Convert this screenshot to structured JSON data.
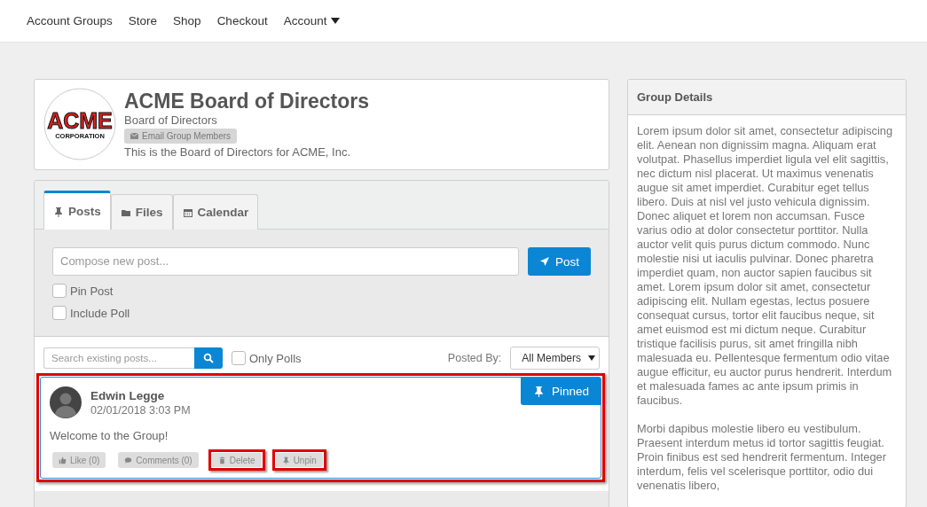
{
  "nav": [
    {
      "label": "Account Groups",
      "dropdown": false
    },
    {
      "label": "Store",
      "dropdown": false
    },
    {
      "label": "Shop",
      "dropdown": false
    },
    {
      "label": "Checkout",
      "dropdown": false
    },
    {
      "label": "Account",
      "dropdown": true
    }
  ],
  "group": {
    "logo": {
      "name": "ACME",
      "subtitle": "CORPORATION"
    },
    "title": "ACME Board of Directors",
    "subtitle": "Board of Directors",
    "email_button": "Email Group Members",
    "description": "This is the Board of Directors for ACME, Inc."
  },
  "tabs": [
    {
      "label": "Posts",
      "kind": "pin",
      "selected": true
    },
    {
      "label": "Files",
      "kind": "folder",
      "selected": false
    },
    {
      "label": "Calendar",
      "kind": "calendar",
      "selected": false
    }
  ],
  "composer": {
    "placeholder": "Compose new post...",
    "post_button": "Post",
    "options": [
      {
        "label": "Pin Post",
        "checked": false
      },
      {
        "label": "Include Poll",
        "checked": false
      }
    ]
  },
  "filter": {
    "search_placeholder": "Search existing posts...",
    "only_polls": {
      "label": "Only Polls",
      "checked": false
    },
    "posted_by_label": "Posted By:",
    "posted_by_value": "All Members"
  },
  "posts": [
    {
      "author": "Edwin Legge",
      "date": "02/01/2018 3:03 PM",
      "body": "Welcome to the Group!",
      "pinned": true,
      "pinned_label": "Pinned",
      "highlighted": true,
      "actions": [
        {
          "label": "Like (0)",
          "kind": "thumb",
          "highlighted": false
        },
        {
          "label": "Comments (0)",
          "kind": "comment",
          "highlighted": false
        },
        {
          "label": "Delete",
          "kind": "trash",
          "highlighted": true
        },
        {
          "label": "Unpin",
          "kind": "pin",
          "highlighted": true
        }
      ]
    }
  ],
  "details": {
    "title": "Group Details",
    "paragraphs": [
      "Lorem ipsum dolor sit amet, consectetur adipiscing elit. Aenean non dignissim magna. Aliquam erat volutpat. Phasellus imperdiet ligula vel elit sagittis, nec dictum nisl placerat. Ut maximus venenatis augue sit amet imperdiet. Curabitur eget tellus libero. Duis at nisl vel justo vehicula dignissim. Donec aliquet et lorem non accumsan. Fusce varius odio at dolor consectetur porttitor. Nulla auctor velit quis purus dictum commodo. Nunc molestie nisi ut iaculis pulvinar. Donec pharetra imperdiet quam, non auctor sapien faucibus sit amet. Lorem ipsum dolor sit amet, consectetur adipiscing elit. Nullam egestas, lectus posuere consequat cursus, tortor elit faucibus neque, sit amet euismod est mi dictum neque. Curabitur tristique facilisis purus, sit amet fringilla nibh malesuada eu. Pellentesque fermentum odio vitae augue efficitur, eu auctor purus hendrerit. Interdum et malesuada fames ac ante ipsum primis in faucibus.",
      "Morbi dapibus molestie libero eu vestibulum. Praesent interdum metus id tortor sagittis feugiat. Proin finibus est sed hendrerit fermentum. Integer interdum, felis vel scelerisque porttitor, odio dui venenatis libero,"
    ]
  }
}
